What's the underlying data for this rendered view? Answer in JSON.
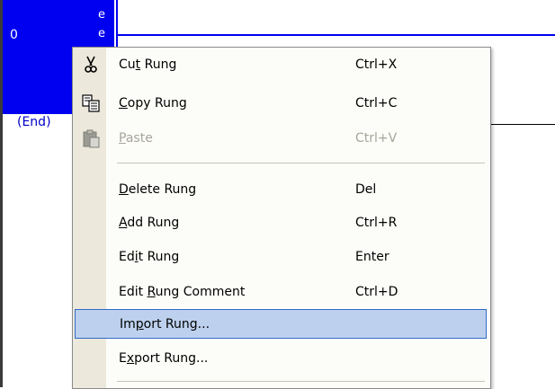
{
  "editor": {
    "rung_number": "0",
    "rung_marker_char": "e",
    "end_label": "(End)",
    "colors": {
      "selection": "#0000f0",
      "end_label": "#0000c8",
      "menu_highlight": "#bdd1ee",
      "menu_highlight_border": "#316ac5"
    }
  },
  "context_menu": {
    "items": [
      {
        "label": "Cut Rung",
        "mnemonic_index": 2,
        "shortcut": "Ctrl+X",
        "icon": "cut-icon",
        "disabled": false,
        "highlighted": false
      },
      {
        "label": "Copy Rung",
        "mnemonic_index": 0,
        "shortcut": "Ctrl+C",
        "icon": "copy-icon",
        "disabled": false,
        "highlighted": false
      },
      {
        "label": "Paste",
        "mnemonic_index": 0,
        "shortcut": "Ctrl+V",
        "icon": "paste-icon",
        "disabled": true,
        "highlighted": false
      },
      {
        "label": "Delete Rung",
        "mnemonic_index": 0,
        "shortcut": "Del",
        "icon": "",
        "disabled": false,
        "highlighted": false
      },
      {
        "label": "Add Rung",
        "mnemonic_index": 0,
        "shortcut": "Ctrl+R",
        "icon": "",
        "disabled": false,
        "highlighted": false
      },
      {
        "label": "Edit Rung",
        "mnemonic_index": 2,
        "shortcut": "Enter",
        "icon": "",
        "disabled": false,
        "highlighted": false
      },
      {
        "label": "Edit Rung Comment",
        "mnemonic_index": 5,
        "shortcut": "Ctrl+D",
        "icon": "",
        "disabled": false,
        "highlighted": false
      },
      {
        "label": "Import Rung...",
        "mnemonic_index": 2,
        "shortcut": "",
        "icon": "",
        "disabled": false,
        "highlighted": true
      },
      {
        "label": "Export Rung...",
        "mnemonic_index": 1,
        "shortcut": "",
        "icon": "",
        "disabled": false,
        "highlighted": false
      }
    ]
  }
}
